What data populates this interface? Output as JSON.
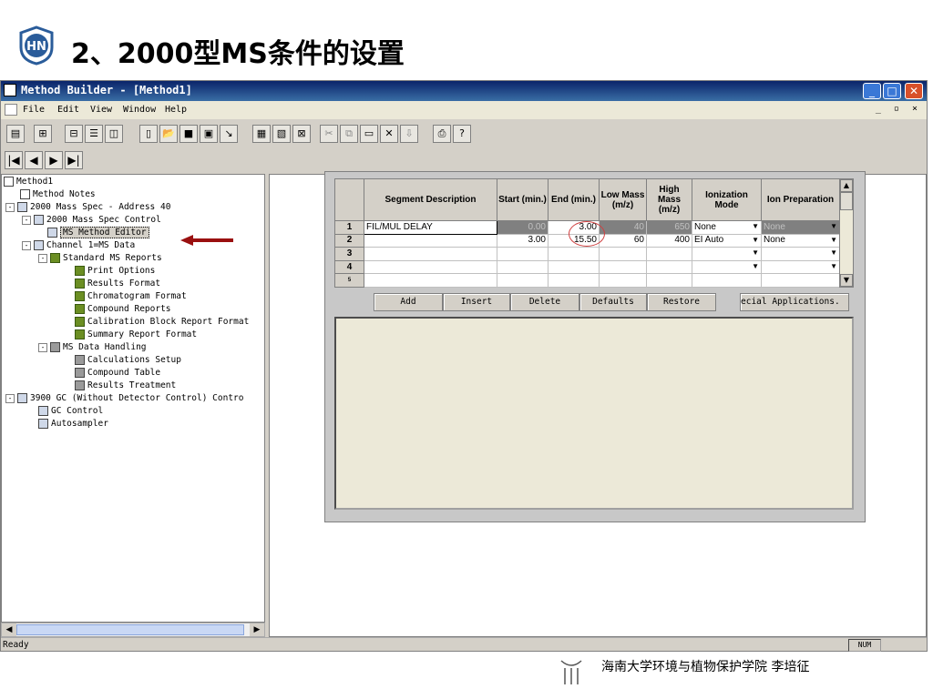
{
  "slide": {
    "title": "2、2000型MS条件的设置",
    "logo_letters": "HN",
    "footer": "海南大学环境与植物保护学院    李培征"
  },
  "window": {
    "title": "Method Builder - [Method1]",
    "controls": {
      "minimize": "_",
      "maximize": "□",
      "close": "✕"
    }
  },
  "menu": {
    "items": [
      "File",
      "Edit",
      "View",
      "Window",
      "Help"
    ],
    "mdi_controls": "_ ▫ ×"
  },
  "nav_buttons": [
    "|◀",
    "◀",
    "▶",
    "▶|"
  ],
  "tree": [
    {
      "label": "Method1",
      "level": 0,
      "icon": "method-icon"
    },
    {
      "label": "Method Notes",
      "level": 1,
      "icon": "notes-icon"
    },
    {
      "label": "2000 Mass Spec - Address 40",
      "level": 1,
      "icon": "ms-icon",
      "exp": "-"
    },
    {
      "label": "2000 Mass Spec Control",
      "level": 2,
      "icon": "ms-icon",
      "exp": "-"
    },
    {
      "label": "MS Method Editor",
      "level": 3,
      "icon": "ms-icon",
      "selected": true
    },
    {
      "label": "Channel 1=MS Data",
      "level": 2,
      "icon": "ms-icon",
      "exp": "-"
    },
    {
      "label": "Standard MS Reports",
      "level": 3,
      "icon": "report-icon",
      "exp": "-"
    },
    {
      "label": "Print Options",
      "level": 4,
      "icon": "report-icon"
    },
    {
      "label": "Results Format",
      "level": 4,
      "icon": "report-icon"
    },
    {
      "label": "Chromatogram Format",
      "level": 4,
      "icon": "report-icon"
    },
    {
      "label": "Compound Reports",
      "level": 4,
      "icon": "report-icon"
    },
    {
      "label": "Calibration Block Report Format",
      "level": 4,
      "icon": "report-icon"
    },
    {
      "label": "Summary Report Format",
      "level": 4,
      "icon": "report-icon"
    },
    {
      "label": "MS Data Handling",
      "level": 3,
      "icon": "data-icon",
      "exp": "-"
    },
    {
      "label": "Calculations Setup",
      "level": 4,
      "icon": "data-icon"
    },
    {
      "label": "Compound Table",
      "level": 4,
      "icon": "data-icon"
    },
    {
      "label": "Results Treatment",
      "level": 4,
      "icon": "data-icon"
    },
    {
      "label": "3900 GC (Without Detector Control) Contro",
      "level": 0,
      "icon": "gc-icon",
      "exp": "-"
    },
    {
      "label": "GC Control",
      "level": 1,
      "icon": "gc-icon"
    },
    {
      "label": "Autosampler",
      "level": 1,
      "icon": "gc-icon"
    }
  ],
  "segment_table": {
    "headers": [
      "",
      "Segment Description",
      "Start (min.)",
      "End (min.)",
      "Low Mass (m/z)",
      "High Mass (m/z)",
      "Ionization Mode",
      "Ion Preparation"
    ],
    "rows": [
      {
        "n": "1",
        "desc": "FIL/MUL DELAY",
        "start": "0.00",
        "end": "3.00",
        "low": "40",
        "high": "650",
        "ion": "None",
        "prep": "None"
      },
      {
        "n": "2",
        "desc": "",
        "start": "3.00",
        "end": "15.50",
        "low": "60",
        "high": "400",
        "ion": "EI Auto",
        "prep": "None"
      },
      {
        "n": "3",
        "desc": "",
        "start": "",
        "end": "",
        "low": "",
        "high": "",
        "ion": "",
        "prep": ""
      },
      {
        "n": "4",
        "desc": "",
        "start": "",
        "end": "",
        "low": "",
        "high": "",
        "ion": "",
        "prep": ""
      },
      {
        "n": "5",
        "desc": "",
        "start": "",
        "end": "",
        "low": "",
        "high": "",
        "ion": "",
        "prep": ""
      }
    ]
  },
  "editor_buttons": {
    "add": "Add",
    "insert": "Insert",
    "delete": "Delete",
    "defaults": "Defaults",
    "restore": "Restore",
    "special": "ecial Applications."
  },
  "status": {
    "ready": "Ready",
    "num": "NUM"
  }
}
